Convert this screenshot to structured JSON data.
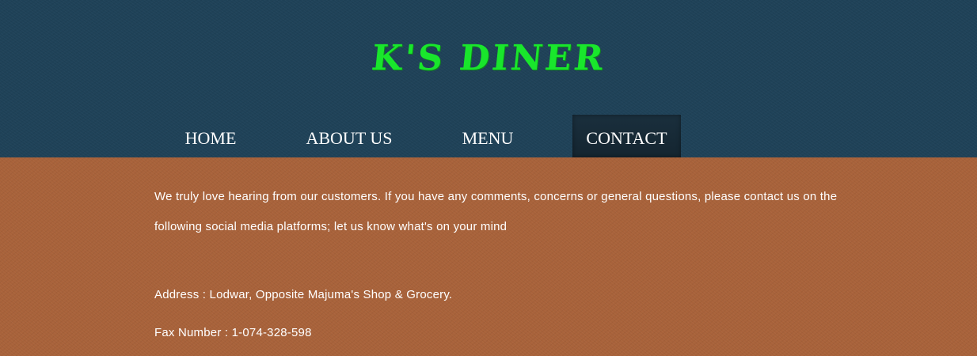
{
  "header": {
    "logo": "K'S DINER"
  },
  "nav": {
    "items": [
      {
        "label": "HOME"
      },
      {
        "label": "ABOUT US"
      },
      {
        "label": "MENU"
      },
      {
        "label": "CONTACT",
        "active": true
      }
    ]
  },
  "content": {
    "intro": "We truly love hearing from our customers. If you have any comments, concerns or general questions, please contact us on the following social media platforms; let us know what's on your mind",
    "address_label": "Address : Lodwar, Opposite Majuma's Shop & Grocery.",
    "fax_label": "Fax Number : 1-074-328-598"
  },
  "colors": {
    "header_bg": "#1f4258",
    "content_bg": "#a8623a",
    "logo": "#19e62c",
    "text": "#ffffff"
  }
}
